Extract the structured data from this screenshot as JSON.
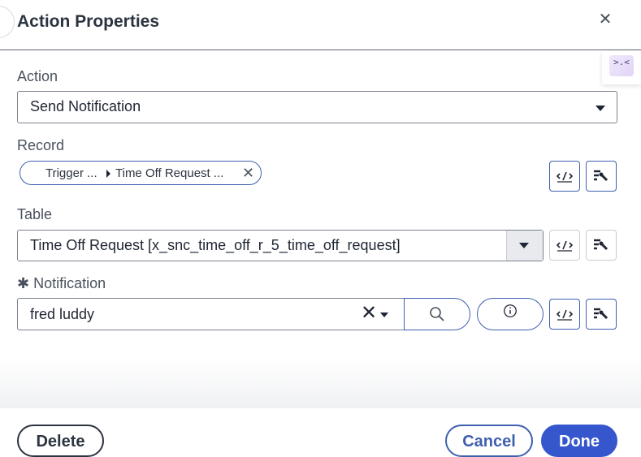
{
  "dialog": {
    "title": "Action Properties"
  },
  "action": {
    "label": "Action",
    "value": "Send Notification"
  },
  "record": {
    "label": "Record",
    "pill_part1": "Trigger ...",
    "pill_part2": "Time Off Request ..."
  },
  "table": {
    "label": "Table",
    "value": "Time Off Request [x_snc_time_off_r_5_time_off_request]"
  },
  "notification": {
    "required_marker": "✱",
    "label": "Notification",
    "value": "fred luddy"
  },
  "footer": {
    "delete": "Delete",
    "cancel": "Cancel",
    "done": "Done"
  },
  "colors": {
    "accent": "#3556cc",
    "outline": "#3f5fae",
    "text": "#1e2533"
  }
}
